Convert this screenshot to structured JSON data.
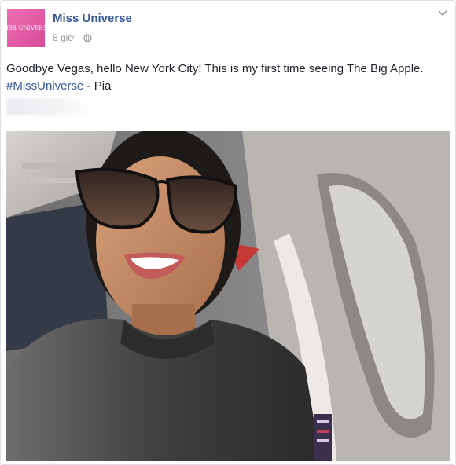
{
  "post": {
    "page_name": "Miss Universe",
    "time": "8 giờ",
    "separator": "·",
    "avatar_logo_text": "MISS UNIVERSE",
    "caption_main": "Goodbye Vegas, hello New York City! This is my first time seeing The Big Apple. ",
    "hashtag": "#MissUniverse",
    "caption_tail": " - Pia"
  },
  "colors": {
    "link": "#365899",
    "avatar_bg": "#e05ca6",
    "meta_text": "#90949c"
  },
  "icons": {
    "privacy": "globe-icon",
    "menu": "chevron-down-icon"
  }
}
